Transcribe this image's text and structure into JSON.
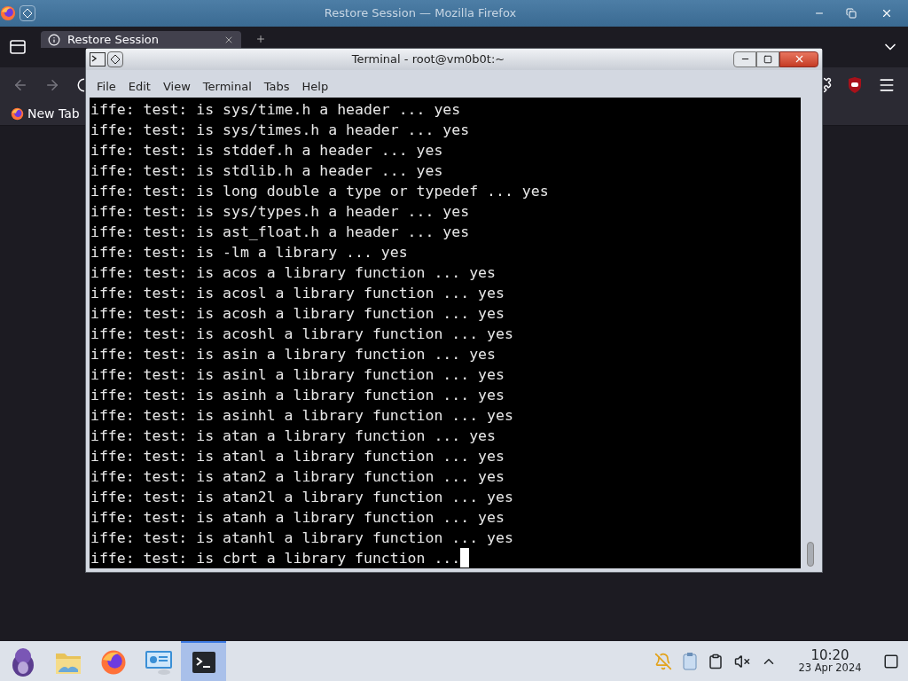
{
  "firefox": {
    "title": "Restore Session — Mozilla Firefox",
    "tab": {
      "title": "Restore Session",
      "selected": true
    },
    "bookmarks": [
      {
        "label": "New Tab"
      }
    ]
  },
  "terminal": {
    "title": "Terminal - root@vm0b0t:~",
    "menu": [
      "File",
      "Edit",
      "View",
      "Terminal",
      "Tabs",
      "Help"
    ],
    "lines": [
      "iffe: test: is sys/time.h a header ... yes",
      "iffe: test: is sys/times.h a header ... yes",
      "iffe: test: is stddef.h a header ... yes",
      "iffe: test: is stdlib.h a header ... yes",
      "iffe: test: is long double a type or typedef ... yes",
      "iffe: test: is sys/types.h a header ... yes",
      "iffe: test: is ast_float.h a header ... yes",
      "iffe: test: is -lm a library ... yes",
      "iffe: test: is acos a library function ... yes",
      "iffe: test: is acosl a library function ... yes",
      "iffe: test: is acosh a library function ... yes",
      "iffe: test: is acoshl a library function ... yes",
      "iffe: test: is asin a library function ... yes",
      "iffe: test: is asinl a library function ... yes",
      "iffe: test: is asinh a library function ... yes",
      "iffe: test: is asinhl a library function ... yes",
      "iffe: test: is atan a library function ... yes",
      "iffe: test: is atanl a library function ... yes",
      "iffe: test: is atan2 a library function ... yes",
      "iffe: test: is atan2l a library function ... yes",
      "iffe: test: is atanh a library function ... yes",
      "iffe: test: is atanhl a library function ... yes",
      "iffe: test: is cbrt a library function ..."
    ],
    "cursor": true
  },
  "taskbar": {
    "apps": [
      {
        "kind": "menu",
        "selected": false
      },
      {
        "kind": "files",
        "selected": false
      },
      {
        "kind": "browser",
        "selected": false
      },
      {
        "kind": "settings",
        "selected": false
      },
      {
        "kind": "terminal",
        "selected": true
      }
    ],
    "clock": {
      "time": "10:20",
      "date": "23 Apr 2024"
    }
  }
}
